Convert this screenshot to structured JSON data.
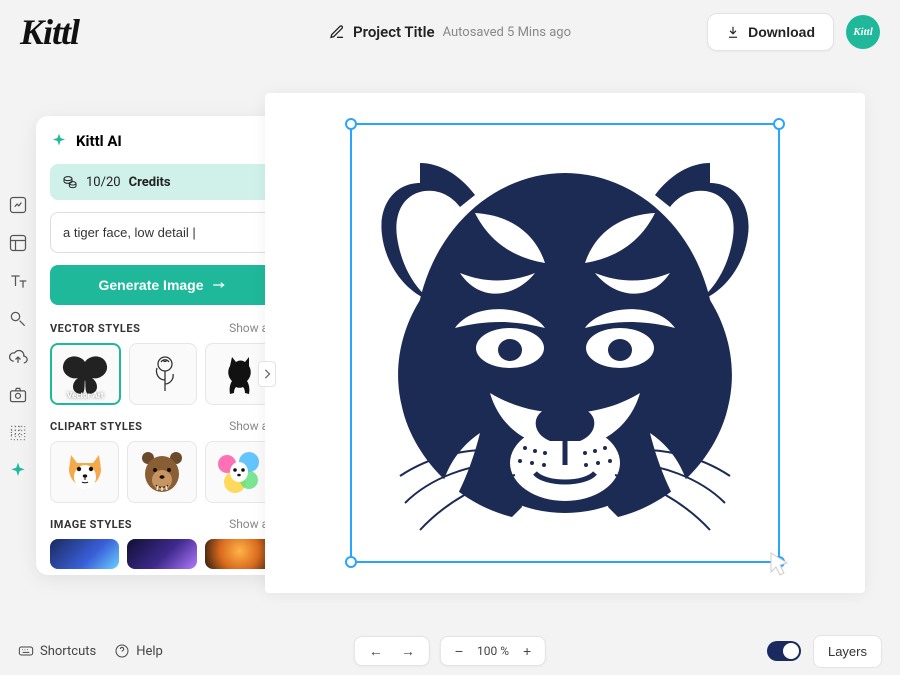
{
  "header": {
    "logo": "Kittl",
    "project_title": "Project Title",
    "autosave": "Autosaved 5 Mins ago",
    "download": "Download",
    "avatar_text": "Kittl"
  },
  "ai_panel": {
    "title": "Kittl AI",
    "credits_count": "10/20",
    "credits_label": "Credits",
    "prompt_value": "a tiger face, low detail |",
    "generate_label": "Generate Image",
    "sections": {
      "vector": {
        "label": "VECTOR STYLES",
        "show_all": "Show all",
        "selected_caption": "Vector Art"
      },
      "clipart": {
        "label": "CLIPART STYLES",
        "show_all": "Show all"
      },
      "image": {
        "label": "IMAGE STYLES",
        "show_all": "Show all"
      }
    }
  },
  "footer": {
    "shortcuts": "Shortcuts",
    "help": "Help",
    "zoom": "100 %",
    "layers": "Layers"
  },
  "colors": {
    "accent": "#1fb89b",
    "selection": "#2aa5ff",
    "tiger": "#1c2b54"
  }
}
